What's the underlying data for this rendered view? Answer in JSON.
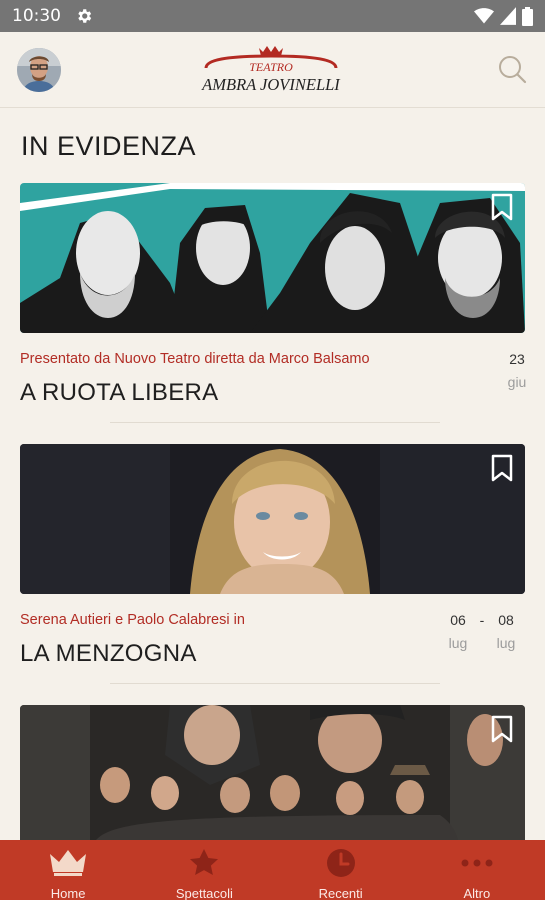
{
  "status_bar": {
    "time": "10:30"
  },
  "header": {
    "logo_line1": "TEATRO",
    "logo_line2": "AMBRA JOVINELLI"
  },
  "section": {
    "title": "IN EVIDENZA"
  },
  "cards": [
    {
      "presenter": "Presentato da  Nuovo Teatro diretta da Marco Balsamo",
      "title": "A RUOTA LIBERA",
      "date_day": "23",
      "date_month": "giu"
    },
    {
      "presenter": "Serena Autieri e Paolo Calabresi in",
      "title": "LA MENZOGNA",
      "date_start_day": "06",
      "date_start_month": "lug",
      "date_separator": "-",
      "date_end_day": "08",
      "date_end_month": "lug"
    }
  ],
  "bottom_nav": {
    "items": [
      {
        "label": "Home",
        "icon": "crown-icon"
      },
      {
        "label": "Spettacoli",
        "icon": "star-icon"
      },
      {
        "label": "Recenti",
        "icon": "clock-icon"
      },
      {
        "label": "Altro",
        "icon": "more-dots-icon"
      }
    ]
  },
  "colors": {
    "accent": "#c03a26",
    "background": "#f5f1ea",
    "status_bar": "#757575",
    "presenter_text": "#b22d25"
  }
}
